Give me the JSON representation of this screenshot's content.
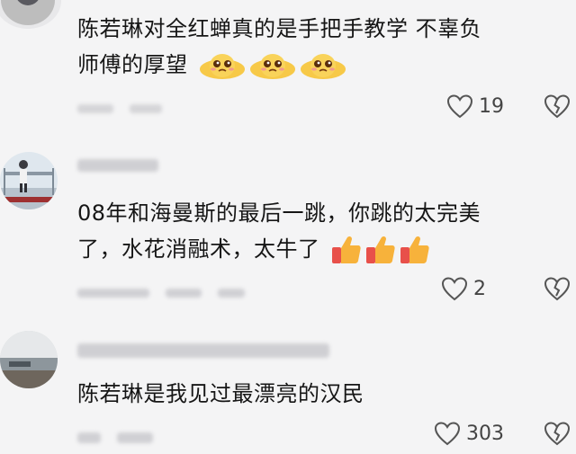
{
  "comments": [
    {
      "username": "",
      "text_line1": "陈若琳对全红蝉真的是手把手教学 不辜负",
      "text_line2": "师傅的厚望",
      "emoji": "pleading-face-emoji",
      "meta": [
        "",
        ""
      ],
      "likes": "19"
    },
    {
      "username": "",
      "text_line1": "08年和海曼斯的最后一跳，你跳的太完美",
      "text_line2": "了，水花消融术，太牛了",
      "emoji": "thumbs-up-emoji",
      "meta": [
        "",
        "",
        ""
      ],
      "likes": "2"
    },
    {
      "username": "",
      "text_line1": "陈若琳是我见过最漂亮的汉民",
      "text_line2": "",
      "emoji": "",
      "meta": [
        "",
        ""
      ],
      "likes": "303"
    }
  ],
  "icons": {
    "like": "heart-outline-icon",
    "dislike": "broken-heart-icon"
  },
  "colors": {
    "background": "#f4f4f5",
    "text": "#161616",
    "muted": "#b9b9bd",
    "emoji_yellow": "#f7c948",
    "thumb_red": "#e8504a"
  }
}
